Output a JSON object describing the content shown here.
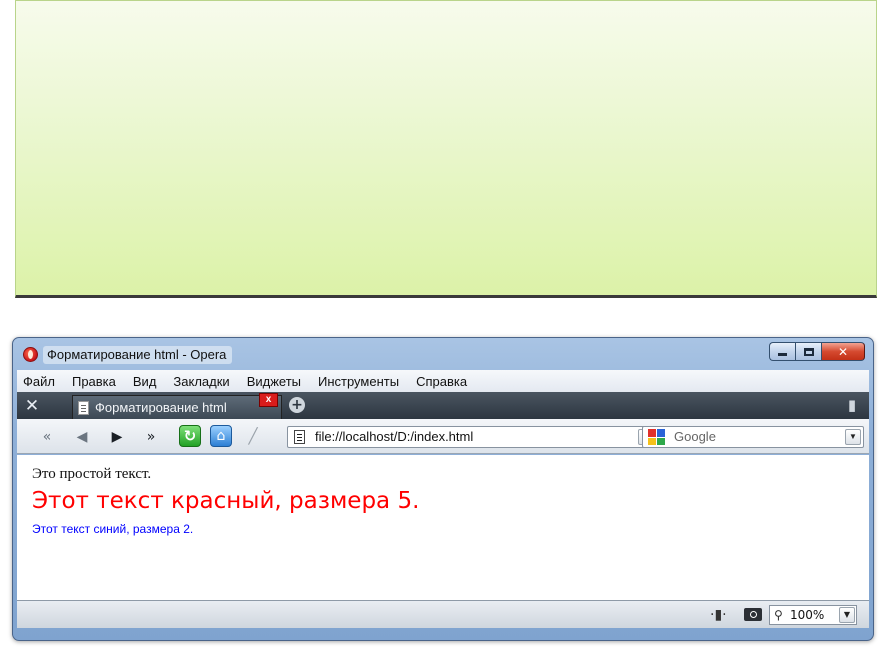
{
  "window": {
    "title": "Форматирование html - Opera"
  },
  "menu": {
    "items": [
      "Файл",
      "Правка",
      "Вид",
      "Закладки",
      "Виджеты",
      "Инструменты",
      "Справка"
    ]
  },
  "tabs": [
    {
      "label": "Форматирование html"
    }
  ],
  "address_bar": {
    "value": "file://localhost/D:/index.html"
  },
  "search_bar": {
    "placeholder": "Google"
  },
  "content": {
    "line1": "Это простой текст.",
    "line2": "Этот текст красный, размера 5.",
    "line3": "Этот текст синий, размера 2.",
    "colors": {
      "line2": "#ff0000",
      "line3": "#0000ff"
    }
  },
  "status_bar": {
    "zoom": "100%"
  }
}
